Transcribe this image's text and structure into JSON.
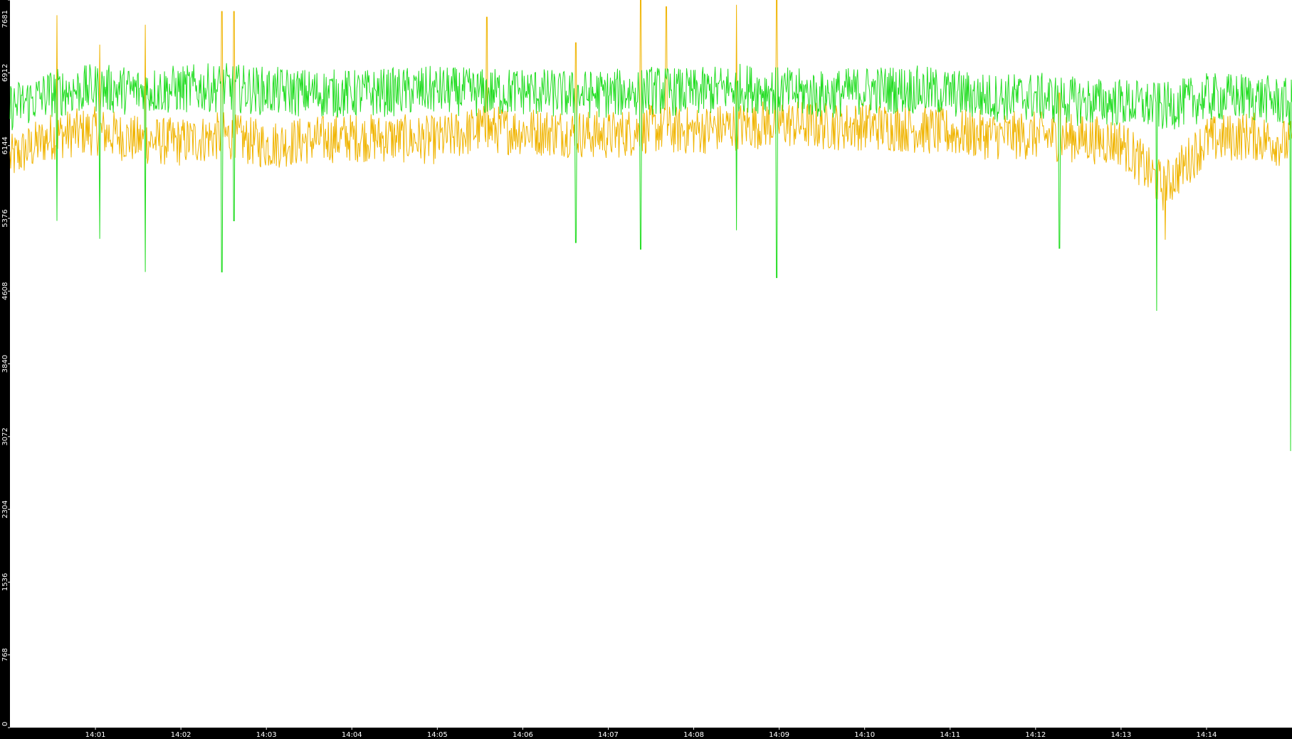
{
  "chart_data": {
    "type": "line",
    "title": "",
    "xlabel": "",
    "ylabel": "",
    "ylim": [
      0,
      7681
    ],
    "y_ticks": [
      0,
      768,
      1536,
      2304,
      3072,
      3840,
      4608,
      5376,
      6144,
      6912,
      7681
    ],
    "x_tick_labels": [
      "14:01",
      "14:02",
      "14:03",
      "14:04",
      "14:05",
      "14:06",
      "14:07",
      "14:08",
      "14:09",
      "14:10",
      "14:11",
      "14:12",
      "14:13",
      "14:14"
    ],
    "x_range_minutes": [
      0,
      15
    ],
    "x_tick_minutes": [
      1,
      2,
      3,
      4,
      5,
      6,
      7,
      8,
      9,
      10,
      11,
      12,
      13,
      14
    ],
    "grid": false,
    "background": "#ffffff",
    "frame_color": "#000000",
    "series": [
      {
        "color": "#22dd22",
        "x": [
          0,
          0.5,
          1,
          1.5,
          2,
          2.5,
          3,
          3.5,
          4,
          4.5,
          5,
          5.5,
          6,
          6.5,
          7,
          7.5,
          8,
          8.5,
          9,
          9.5,
          10,
          10.5,
          11,
          11.5,
          12,
          12.5,
          13,
          13.5,
          14,
          14.5,
          15
        ],
        "values": [
          6550,
          6700,
          6750,
          6720,
          6740,
          6760,
          6720,
          6700,
          6690,
          6710,
          6730,
          6700,
          6720,
          6680,
          6690,
          6730,
          6700,
          6760,
          6720,
          6680,
          6730,
          6740,
          6700,
          6650,
          6660,
          6610,
          6600,
          6550,
          6650,
          6660,
          6590
        ],
        "spikes": [
          {
            "x": 0.55,
            "value": 5350
          },
          {
            "x": 1.05,
            "value": 5160
          },
          {
            "x": 1.58,
            "value": 4810
          },
          {
            "x": 2.48,
            "value": 4810
          },
          {
            "x": 2.62,
            "value": 5350
          },
          {
            "x": 6.62,
            "value": 5120
          },
          {
            "x": 7.38,
            "value": 5050
          },
          {
            "x": 8.5,
            "value": 5250
          },
          {
            "x": 8.97,
            "value": 4750
          },
          {
            "x": 12.28,
            "value": 5060
          },
          {
            "x": 13.42,
            "value": 4400
          },
          {
            "x": 14.98,
            "value": 2920
          }
        ]
      },
      {
        "color": "#f0b400",
        "x": [
          0,
          0.5,
          1,
          1.5,
          2,
          2.5,
          3,
          3.5,
          4,
          4.5,
          5,
          5.5,
          6,
          6.5,
          7,
          7.5,
          8,
          8.5,
          9,
          9.5,
          10,
          10.5,
          11,
          11.5,
          12,
          12.5,
          13,
          13.5,
          14,
          14.5,
          15
        ],
        "values": [
          6000,
          6250,
          6300,
          6200,
          6180,
          6250,
          6150,
          6200,
          6230,
          6220,
          6200,
          6320,
          6300,
          6280,
          6250,
          6320,
          6300,
          6350,
          6380,
          6350,
          6350,
          6330,
          6280,
          6250,
          6250,
          6220,
          6180,
          5700,
          6200,
          6250,
          6150
        ],
        "spikes": [
          {
            "x": 0.55,
            "value": 7520
          },
          {
            "x": 1.05,
            "value": 7210
          },
          {
            "x": 1.58,
            "value": 7420
          },
          {
            "x": 2.48,
            "value": 7560
          },
          {
            "x": 2.62,
            "value": 7560
          },
          {
            "x": 5.58,
            "value": 7500
          },
          {
            "x": 6.62,
            "value": 7230
          },
          {
            "x": 7.38,
            "value": 7680
          },
          {
            "x": 7.68,
            "value": 7610
          },
          {
            "x": 8.5,
            "value": 7630
          },
          {
            "x": 8.97,
            "value": 7680
          },
          {
            "x": 12.28,
            "value": 6700
          },
          {
            "x": 13.52,
            "value": 5150
          }
        ]
      }
    ]
  }
}
